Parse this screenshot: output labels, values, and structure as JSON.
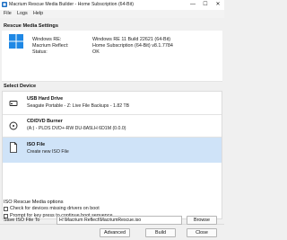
{
  "window": {
    "title": "Macrium Rescue Media Builder - Home Subscription (64-Bit)",
    "minimize_glyph": "—",
    "maximize_glyph": "☐",
    "close_glyph": "✕"
  },
  "menu": {
    "file": "File",
    "logs": "Logs",
    "help": "Help"
  },
  "rescue_settings": {
    "heading": "Rescue Media Settings",
    "rows": [
      {
        "label": "Windows RE:",
        "value": "Windows RE 11 Build 22621 (64-Bit)"
      },
      {
        "label": "Macrium Reflect:",
        "value": "Home Subscription (64-Bit) v8.1.7784"
      },
      {
        "label": "Status:",
        "value": "OK"
      }
    ]
  },
  "select_device": {
    "heading": "Select Device",
    "devices": [
      {
        "title": "USB Hard Drive",
        "subtitle": "Seagate Portable - Z: Live File Backups - 1.82 TB",
        "icon": "usb-drive-icon"
      },
      {
        "title": "CD/DVD Burner",
        "subtitle": "(A:) - PLDS     DVD+-RW DU-8A5LH  6D1M (0.0.0)",
        "icon": "optical-disc-icon"
      },
      {
        "title": "ISO File",
        "subtitle": "Create new ISO File",
        "icon": "iso-file-icon",
        "selected": true
      }
    ]
  },
  "iso_options": {
    "heading": "ISO Rescue Media options",
    "check_missing_drivers": "Check for devices missing drivers on boot",
    "prompt_key": "Prompt for key press to continue boot sequence",
    "check_missing_drivers_checked": false,
    "prompt_key_checked": false
  },
  "save_iso": {
    "label": "Save ISO File To",
    "path": "H:\\Macrium Reflect\\MacriumRescue.iso",
    "browse": "Browse"
  },
  "footer": {
    "advanced": "Advanced",
    "build": "Build",
    "close": "Close"
  },
  "colors": {
    "selection": "#cfe3f8",
    "accent": "#0a64c8"
  }
}
